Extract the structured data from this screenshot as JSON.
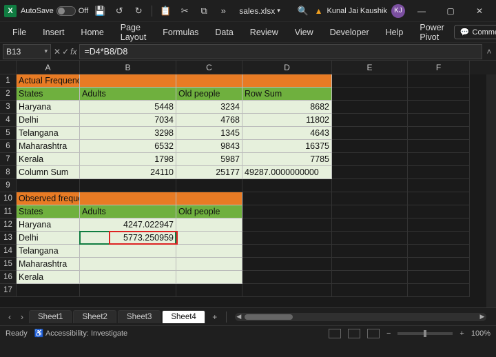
{
  "titlebar": {
    "autosave_label": "AutoSave",
    "autosave_state": "Off",
    "filename": "sales.xlsx",
    "username": "Kunal Jai Kaushik",
    "user_initials": "KJ"
  },
  "ribbon": {
    "tabs": [
      "File",
      "Insert",
      "Home",
      "Page Layout",
      "Formulas",
      "Data",
      "Review",
      "View",
      "Developer",
      "Help",
      "Power Pivot"
    ],
    "comments_label": "Comments"
  },
  "formula_bar": {
    "cell_ref": "B13",
    "formula": "=D4*B8/D8"
  },
  "columns": [
    "A",
    "B",
    "C",
    "D",
    "E",
    "F"
  ],
  "col_widths": {
    "A": 92,
    "B": 140,
    "C": 96,
    "D": 130,
    "E": 110,
    "F": 90
  },
  "row_count": 17,
  "table1": {
    "title": "Actual Frequencies of liking Ice cream",
    "headers": [
      "States",
      "Adults",
      "Old people",
      "Row Sum"
    ],
    "rows": [
      {
        "state": "Haryana",
        "adults": "5448",
        "old": "3234",
        "sum": "8682"
      },
      {
        "state": "Delhi",
        "adults": "7034",
        "old": "4768",
        "sum": "11802"
      },
      {
        "state": "Telangana",
        "adults": "3298",
        "old": "1345",
        "sum": "4643"
      },
      {
        "state": "Maharashtra",
        "adults": "6532",
        "old": "9843",
        "sum": "16375"
      },
      {
        "state": "Kerala",
        "adults": "1798",
        "old": "5987",
        "sum": "7785"
      },
      {
        "state": "Column Sum",
        "adults": "24110",
        "old": "25177",
        "sum": "49287.0000000000"
      }
    ]
  },
  "table2": {
    "title": "Observed frequencies of liking Ice cream",
    "headers": [
      "States",
      "Adults",
      "Old people"
    ],
    "rows": [
      {
        "state": "Haryana",
        "adults": "4247.022947",
        "old": ""
      },
      {
        "state": "Delhi",
        "adults": "5773.250959",
        "old": ""
      },
      {
        "state": "Telangana",
        "adults": "",
        "old": ""
      },
      {
        "state": "Maharashtra",
        "adults": "",
        "old": ""
      },
      {
        "state": "Kerala",
        "adults": "",
        "old": ""
      }
    ]
  },
  "sheets": {
    "tabs": [
      "Sheet1",
      "Sheet2",
      "Sheet3",
      "Sheet4"
    ],
    "active_index": 3
  },
  "status": {
    "mode": "Ready",
    "accessibility": "Accessibility: Investigate",
    "zoom": "100%"
  }
}
